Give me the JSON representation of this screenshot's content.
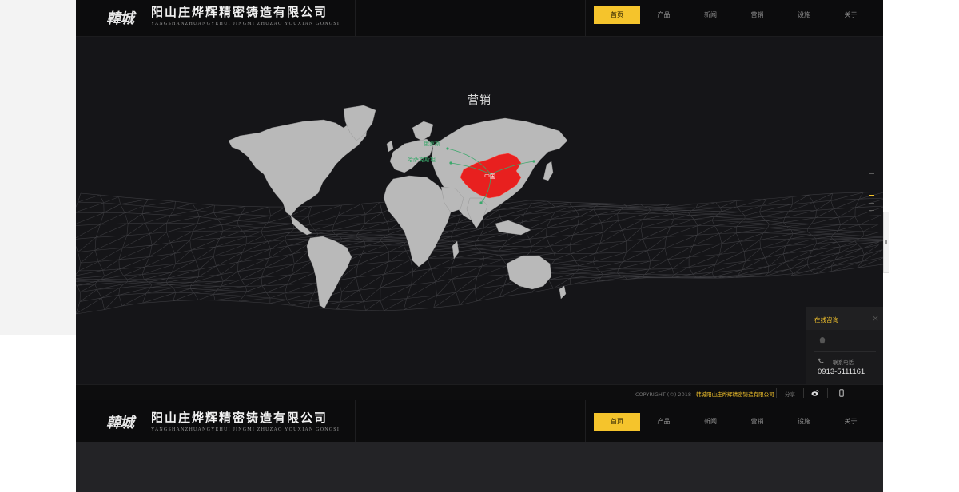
{
  "brand": {
    "logo_text": "韓城",
    "company_name": "阳山庄烨辉精密铸造有限公司",
    "company_pinyin": "YANGSHANZHUANGYEHUI JINGMI ZHUZAO YOUXIAN GONGSI"
  },
  "nav": {
    "items": [
      {
        "label": "首页",
        "active": true
      },
      {
        "label": "产品",
        "active": false
      },
      {
        "label": "新闻",
        "active": false
      },
      {
        "label": "营销",
        "active": false
      },
      {
        "label": "设施",
        "active": false
      },
      {
        "label": "关于",
        "active": false
      }
    ]
  },
  "section": {
    "title": "营销"
  },
  "map": {
    "labels": {
      "russia": "俄罗斯",
      "kazakhstan": "哈萨克斯坦",
      "china": "中国"
    },
    "highlight_color": "#e8201f",
    "land_color": "#b9b9b9",
    "label_color": "#3aa86b"
  },
  "footer": {
    "copyright": "COPYRIGHT (©) 2018",
    "company_link": "韩城阳山庄烨辉精密铸造有限公司",
    "share_label": "分享",
    "icons": [
      "weibo-icon",
      "mobile-icon"
    ]
  },
  "consult": {
    "title": "在线咨询",
    "close_glyph": "×",
    "phone_label": "联系电话",
    "phone_number": "0913-5111161"
  },
  "colors": {
    "accent": "#f5c42c",
    "header_bg": "#0c0c0d",
    "hero_bg": "#151518"
  }
}
